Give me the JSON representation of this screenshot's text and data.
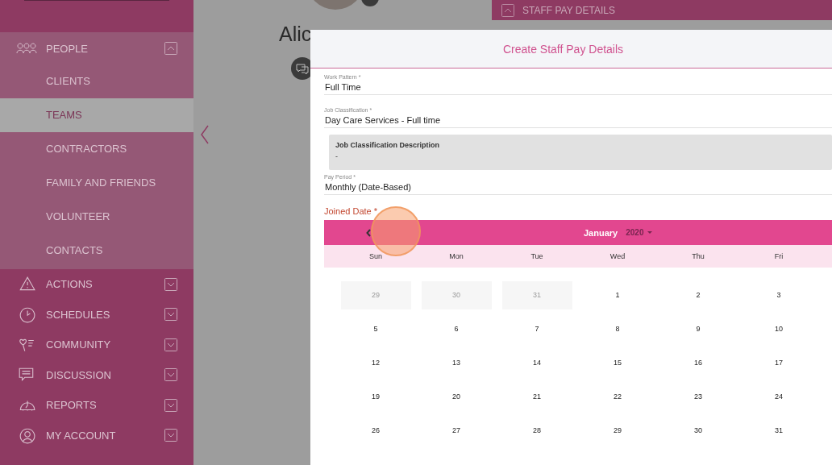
{
  "sidebar": {
    "group": {
      "label": "PEOPLE",
      "expanded": true,
      "children": [
        {
          "label": "CLIENTS",
          "selected": false
        },
        {
          "label": "TEAMS",
          "selected": true
        },
        {
          "label": "CONTRACTORS",
          "selected": false
        },
        {
          "label": "FAMILY AND FRIENDS",
          "selected": false
        },
        {
          "label": "VOLUNTEER",
          "selected": false
        },
        {
          "label": "CONTACTS",
          "selected": false
        }
      ]
    },
    "items": [
      {
        "label": "ACTIONS",
        "expanded": false
      },
      {
        "label": "SCHEDULES",
        "expanded": false
      },
      {
        "label": "COMMUNITY",
        "expanded": false
      },
      {
        "label": "DISCUSSION",
        "expanded": false
      },
      {
        "label": "REPORTS",
        "expanded": false
      },
      {
        "label": "MY ACCOUNT",
        "expanded": false
      }
    ]
  },
  "profile": {
    "name": "Alic"
  },
  "section": {
    "title": "STAFF PAY DETAILS",
    "expanded": true
  },
  "modal": {
    "title": "Create Staff Pay Details",
    "fields": [
      {
        "label": "Work Pattern *",
        "value": "Full Time"
      },
      {
        "label": "Job Classification *",
        "value": "Day Care Services - Full time"
      }
    ],
    "description": {
      "label": "Job Classification Description",
      "value": "-"
    },
    "pay_period": {
      "label": "Pay Period *",
      "value": "Monthly (Date-Based)"
    },
    "date_label": "Joined Date *",
    "calendar": {
      "month": "January",
      "year": "2020",
      "weekdays": [
        "Sun",
        "Mon",
        "Tue",
        "Wed",
        "Thu",
        "Fri"
      ],
      "weeks": [
        [
          {
            "day": "29",
            "muted": true
          },
          {
            "day": "30",
            "muted": true
          },
          {
            "day": "31",
            "muted": true
          },
          {
            "day": "1",
            "muted": false
          },
          {
            "day": "2",
            "muted": false
          },
          {
            "day": "3",
            "muted": false
          }
        ],
        [
          {
            "day": "5",
            "muted": false
          },
          {
            "day": "6",
            "muted": false
          },
          {
            "day": "7",
            "muted": false
          },
          {
            "day": "8",
            "muted": false
          },
          {
            "day": "9",
            "muted": false
          },
          {
            "day": "10",
            "muted": false
          }
        ],
        [
          {
            "day": "12",
            "muted": false
          },
          {
            "day": "13",
            "muted": false
          },
          {
            "day": "14",
            "muted": false
          },
          {
            "day": "15",
            "muted": false
          },
          {
            "day": "16",
            "muted": false
          },
          {
            "day": "17",
            "muted": false
          }
        ],
        [
          {
            "day": "19",
            "muted": false
          },
          {
            "day": "20",
            "muted": false
          },
          {
            "day": "21",
            "muted": false
          },
          {
            "day": "22",
            "muted": false
          },
          {
            "day": "23",
            "muted": false
          },
          {
            "day": "24",
            "muted": false
          }
        ],
        [
          {
            "day": "26",
            "muted": false
          },
          {
            "day": "27",
            "muted": false
          },
          {
            "day": "28",
            "muted": false
          },
          {
            "day": "29",
            "muted": false
          },
          {
            "day": "30",
            "muted": false
          },
          {
            "day": "31",
            "muted": false
          }
        ]
      ]
    }
  }
}
